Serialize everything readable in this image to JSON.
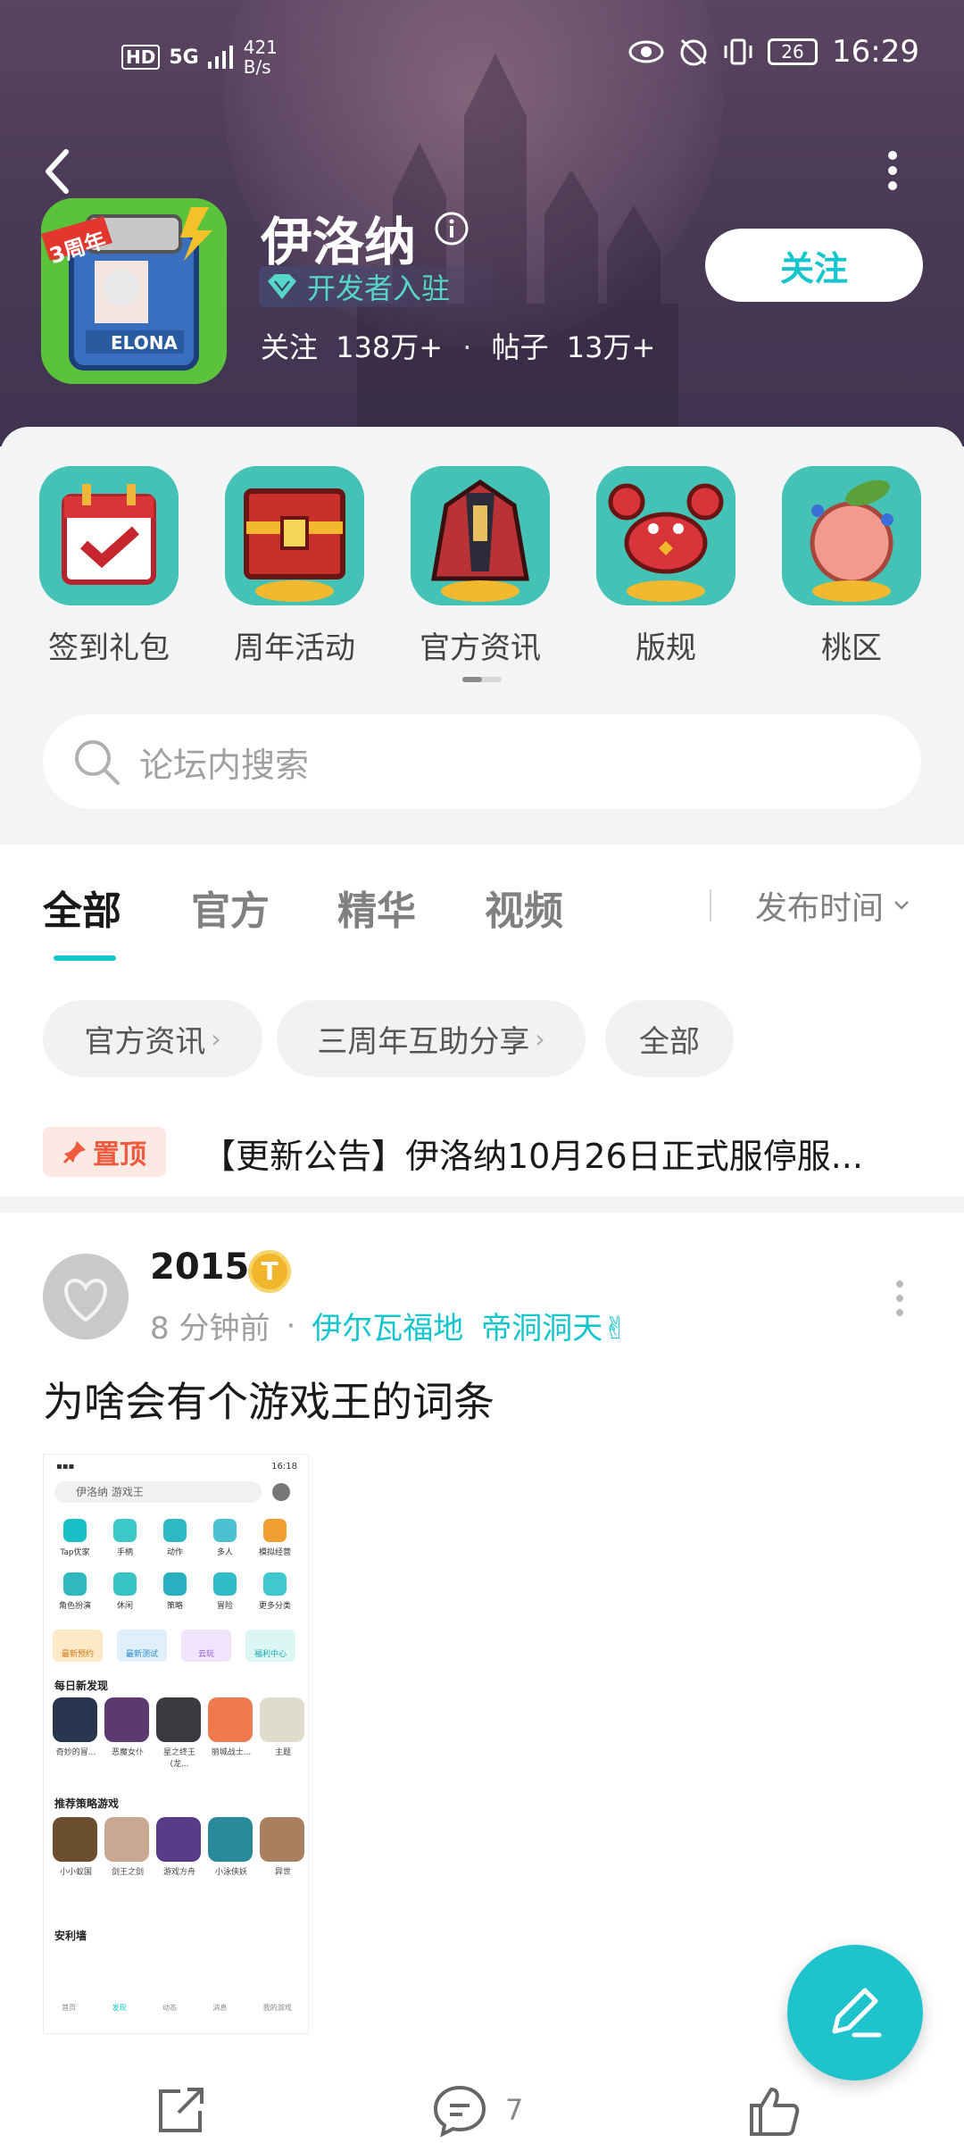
{
  "status_bar": {
    "network": "HD",
    "signal": "5G",
    "speed_value": "421",
    "speed_unit": "B/s",
    "battery": "26",
    "time": "16:29"
  },
  "forum": {
    "title": "伊洛纳",
    "dev_badge": "开发者入驻",
    "follow_label": "关注",
    "follow_count": "138万+",
    "post_label": "帖子",
    "post_count": "13万+",
    "follow_button": "关注",
    "icon_text": "ELONA",
    "icon_ribbon": "3周年"
  },
  "shortcuts": [
    {
      "label": "签到礼包",
      "icon": "calendar-check-icon"
    },
    {
      "label": "周年活动",
      "icon": "treasure-chest-icon"
    },
    {
      "label": "官方资讯",
      "icon": "cloak-icon"
    },
    {
      "label": "版规",
      "icon": "crab-icon"
    },
    {
      "label": "桃区",
      "icon": "peach-icon"
    }
  ],
  "search": {
    "placeholder": "论坛内搜索"
  },
  "tabs": [
    {
      "label": "全部",
      "active": true
    },
    {
      "label": "官方",
      "active": false
    },
    {
      "label": "精华",
      "active": false
    },
    {
      "label": "视频",
      "active": false
    }
  ],
  "sort": {
    "label": "发布时间"
  },
  "chips": [
    {
      "label": "官方资讯",
      "chevron": "›"
    },
    {
      "label": "三周年互助分享",
      "chevron": "›"
    },
    {
      "label": "全部",
      "chevron": ""
    }
  ],
  "pinned": {
    "tag": "置顶",
    "text": "【更新公告】伊洛纳10月26日正式服停服..."
  },
  "post": {
    "author": "2015",
    "badge": "T",
    "time_ago": "8 分钟前",
    "board": "伊尔瓦福地",
    "tag": "帝洞洞天✌",
    "title": "为啥会有个游戏王的词条",
    "comment_count": "7"
  },
  "screenshot": {
    "status_left": "▪▪▪",
    "status_time": "16:18",
    "search_text": "伊洛纳 游戏王",
    "categories": [
      "Tap优家",
      "手柄",
      "动作",
      "多人",
      "模拟经营",
      "角色扮演",
      "休闲",
      "策略",
      "冒险",
      "更多分类"
    ],
    "pills": [
      "最新预约",
      "最新测试",
      "云玩",
      "福利中心"
    ],
    "section1": "每日新发现",
    "games1": [
      "奇妙的冒...",
      "恶魔女仆",
      "星之终王(龙...",
      "丽城战士...",
      "主题"
    ],
    "section2": "推荐策略游戏",
    "games2": [
      "小小蚁国",
      "剑王之剑",
      "游戏方舟",
      "小泳侠妖",
      "异世"
    ],
    "section3": "安利墙",
    "nav": [
      "首页",
      "发现",
      "动态",
      "消息",
      "我的游戏"
    ]
  },
  "colors": {
    "accent": "#15c5ce",
    "pin": "#f05a3e",
    "header": "#4a3a55"
  }
}
